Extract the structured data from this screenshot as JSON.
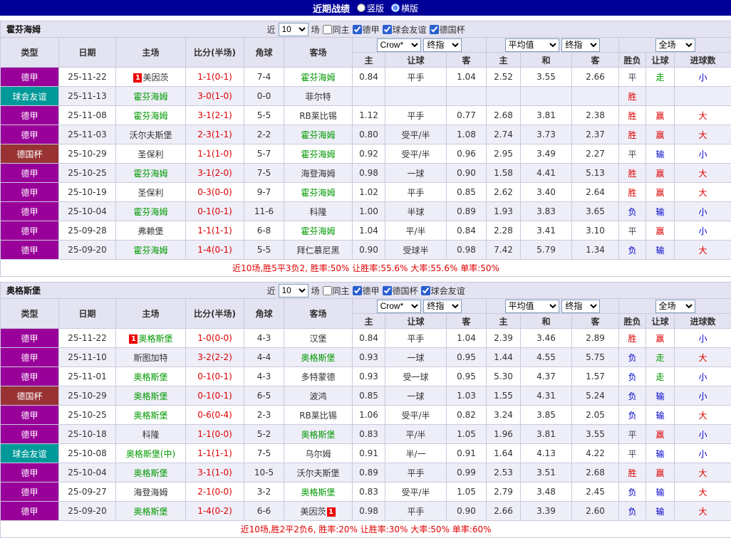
{
  "topbar": {
    "title": "近期战绩",
    "radios": [
      {
        "label": "竖版",
        "selected": false
      },
      {
        "label": "横版",
        "selected": true
      }
    ]
  },
  "colors": {
    "type": {
      "德甲": "#990099",
      "球会友谊": "#009999",
      "德国杯": "#993333"
    },
    "values": {
      "胜": "#dd0000",
      "平": "#444455",
      "负": "#0000cc",
      "赢": "#dd0000",
      "走": "#009900",
      "输": "#0000cc",
      "大": "#dd0000",
      "小": "#0000cc"
    },
    "focus_team": "#009900",
    "score": "#dd0000",
    "badge_bg": "#ee0000",
    "summary": "#e00000"
  },
  "table": {
    "columns": [
      "类型",
      "日期",
      "主场",
      "比分(半场)",
      "角球",
      "客场",
      "主",
      "让球",
      "客",
      "主",
      "和",
      "客",
      "胜负",
      "让球",
      "进球数"
    ]
  },
  "sections": [
    {
      "team": "霍芬海姆",
      "filters": {
        "prefix": "近",
        "count": "10",
        "suffix": "场",
        "checkboxes": [
          {
            "label": "同主",
            "checked": false
          },
          {
            "label": "德甲",
            "checked": true
          },
          {
            "label": "球会友谊",
            "checked": true
          },
          {
            "label": "德国杯",
            "checked": true
          }
        ]
      },
      "selects": {
        "asia_company": "Crow*",
        "asia_stage": "终指",
        "europe_company": "平均值",
        "europe_stage": "终指",
        "scope": "全场"
      },
      "rows": [
        {
          "type": "德甲",
          "date": "25-11-22",
          "home": "美因茨",
          "home_badge": "1",
          "home_badge_pos": "left",
          "home_focus": false,
          "score": "1-1(0-1)",
          "corner": "7-4",
          "away": "霍芬海姆",
          "away_focus": true,
          "ah": [
            "0.84",
            "平手",
            "1.04"
          ],
          "eu": [
            "2.52",
            "3.55",
            "2.66"
          ],
          "res": [
            "平",
            "走",
            "小"
          ]
        },
        {
          "type": "球会友谊",
          "date": "25-11-13",
          "home": "霍芬海姆",
          "home_focus": true,
          "score": "3-0(1-0)",
          "corner": "0-0",
          "away": "菲尔特",
          "away_focus": false,
          "ah": [
            "",
            "",
            ""
          ],
          "eu": [
            "",
            "",
            ""
          ],
          "res": [
            "胜",
            "",
            ""
          ]
        },
        {
          "type": "德甲",
          "date": "25-11-08",
          "home": "霍芬海姆",
          "home_focus": true,
          "score": "3-1(2-1)",
          "corner": "5-5",
          "away": "RB莱比锡",
          "away_focus": false,
          "ah": [
            "1.12",
            "平手",
            "0.77"
          ],
          "eu": [
            "2.68",
            "3.81",
            "2.38"
          ],
          "res": [
            "胜",
            "赢",
            "大"
          ]
        },
        {
          "type": "德甲",
          "date": "25-11-03",
          "home": "沃尔夫斯堡",
          "home_focus": false,
          "score": "2-3(1-1)",
          "corner": "2-2",
          "away": "霍芬海姆",
          "away_focus": true,
          "ah": [
            "0.80",
            "受平/半",
            "1.08"
          ],
          "eu": [
            "2.74",
            "3.73",
            "2.37"
          ],
          "res": [
            "胜",
            "赢",
            "大"
          ]
        },
        {
          "type": "德国杯",
          "date": "25-10-29",
          "home": "圣保利",
          "home_focus": false,
          "score": "1-1(1-0)",
          "corner": "5-7",
          "away": "霍芬海姆",
          "away_focus": true,
          "ah": [
            "0.92",
            "受平/半",
            "0.96"
          ],
          "eu": [
            "2.95",
            "3.49",
            "2.27"
          ],
          "res": [
            "平",
            "输",
            "小"
          ]
        },
        {
          "type": "德甲",
          "date": "25-10-25",
          "home": "霍芬海姆",
          "home_focus": true,
          "score": "3-1(2-0)",
          "corner": "7-5",
          "away": "海登海姆",
          "away_focus": false,
          "ah": [
            "0.98",
            "一球",
            "0.90"
          ],
          "eu": [
            "1.58",
            "4.41",
            "5.13"
          ],
          "res": [
            "胜",
            "赢",
            "大"
          ]
        },
        {
          "type": "德甲",
          "date": "25-10-19",
          "home": "圣保利",
          "home_focus": false,
          "score": "0-3(0-0)",
          "corner": "9-7",
          "away": "霍芬海姆",
          "away_focus": true,
          "ah": [
            "1.02",
            "平手",
            "0.85"
          ],
          "eu": [
            "2.62",
            "3.40",
            "2.64"
          ],
          "res": [
            "胜",
            "赢",
            "大"
          ]
        },
        {
          "type": "德甲",
          "date": "25-10-04",
          "home": "霍芬海姆",
          "home_focus": true,
          "score": "0-1(0-1)",
          "corner": "11-6",
          "away": "科隆",
          "away_focus": false,
          "ah": [
            "1.00",
            "半球",
            "0.89"
          ],
          "eu": [
            "1.93",
            "3.83",
            "3.65"
          ],
          "res": [
            "负",
            "输",
            "小"
          ]
        },
        {
          "type": "德甲",
          "date": "25-09-28",
          "home": "弗赖堡",
          "home_focus": false,
          "score": "1-1(1-1)",
          "corner": "6-8",
          "away": "霍芬海姆",
          "away_focus": true,
          "ah": [
            "1.04",
            "平/半",
            "0.84"
          ],
          "eu": [
            "2.28",
            "3.41",
            "3.10"
          ],
          "res": [
            "平",
            "赢",
            "小"
          ]
        },
        {
          "type": "德甲",
          "date": "25-09-20",
          "home": "霍芬海姆",
          "home_focus": true,
          "score": "1-4(0-1)",
          "corner": "5-5",
          "away": "拜仁慕尼黑",
          "away_focus": false,
          "ah": [
            "0.90",
            "受球半",
            "0.98"
          ],
          "eu": [
            "7.42",
            "5.79",
            "1.34"
          ],
          "res": [
            "负",
            "输",
            "大"
          ]
        }
      ],
      "summary": "近10场,胜5平3负2, 胜率:50% 让胜率:55.6% 大率:55.6% 单率:50%"
    },
    {
      "team": "奥格斯堡",
      "filters": {
        "prefix": "近",
        "count": "10",
        "suffix": "场",
        "checkboxes": [
          {
            "label": "同主",
            "checked": false
          },
          {
            "label": "德甲",
            "checked": true
          },
          {
            "label": "德国杯",
            "checked": true
          },
          {
            "label": "球会友谊",
            "checked": true
          }
        ]
      },
      "selects": {
        "asia_company": "Crow*",
        "asia_stage": "终指",
        "europe_company": "平均值",
        "europe_stage": "终指",
        "scope": "全场"
      },
      "rows": [
        {
          "type": "德甲",
          "date": "25-11-22",
          "home": "奥格斯堡",
          "home_badge": "1",
          "home_badge_pos": "left",
          "home_focus": true,
          "score": "1-0(0-0)",
          "corner": "4-3",
          "away": "汉堡",
          "away_focus": false,
          "ah": [
            "0.84",
            "平手",
            "1.04"
          ],
          "eu": [
            "2.39",
            "3.46",
            "2.89"
          ],
          "res": [
            "胜",
            "赢",
            "小"
          ]
        },
        {
          "type": "德甲",
          "date": "25-11-10",
          "home": "斯图加特",
          "home_focus": false,
          "score": "3-2(2-2)",
          "corner": "4-4",
          "away": "奥格斯堡",
          "away_focus": true,
          "ah": [
            "0.93",
            "一球",
            "0.95"
          ],
          "eu": [
            "1.44",
            "4.55",
            "5.75"
          ],
          "res": [
            "负",
            "走",
            "大"
          ]
        },
        {
          "type": "德甲",
          "date": "25-11-01",
          "home": "奥格斯堡",
          "home_focus": true,
          "score": "0-1(0-1)",
          "corner": "4-3",
          "away": "多特蒙德",
          "away_focus": false,
          "ah": [
            "0.93",
            "受一球",
            "0.95"
          ],
          "eu": [
            "5.30",
            "4.37",
            "1.57"
          ],
          "res": [
            "负",
            "走",
            "小"
          ]
        },
        {
          "type": "德国杯",
          "date": "25-10-29",
          "home": "奥格斯堡",
          "home_focus": true,
          "score": "0-1(0-1)",
          "corner": "6-5",
          "away": "波鸿",
          "away_focus": false,
          "ah": [
            "0.85",
            "一球",
            "1.03"
          ],
          "eu": [
            "1.55",
            "4.31",
            "5.24"
          ],
          "res": [
            "负",
            "输",
            "小"
          ]
        },
        {
          "type": "德甲",
          "date": "25-10-25",
          "home": "奥格斯堡",
          "home_focus": true,
          "score": "0-6(0-4)",
          "corner": "2-3",
          "away": "RB莱比锡",
          "away_focus": false,
          "ah": [
            "1.06",
            "受平/半",
            "0.82"
          ],
          "eu": [
            "3.24",
            "3.85",
            "2.05"
          ],
          "res": [
            "负",
            "输",
            "大"
          ]
        },
        {
          "type": "德甲",
          "date": "25-10-18",
          "home": "科隆",
          "home_focus": false,
          "score": "1-1(0-0)",
          "corner": "5-2",
          "away": "奥格斯堡",
          "away_focus": true,
          "ah": [
            "0.83",
            "平/半",
            "1.05"
          ],
          "eu": [
            "1.96",
            "3.81",
            "3.55"
          ],
          "res": [
            "平",
            "赢",
            "小"
          ]
        },
        {
          "type": "球会友谊",
          "date": "25-10-08",
          "home": "奥格斯堡(中)",
          "home_focus": true,
          "score": "1-1(1-1)",
          "corner": "7-5",
          "away": "乌尔姆",
          "away_focus": false,
          "ah": [
            "0.91",
            "半/一",
            "0.91"
          ],
          "eu": [
            "1.64",
            "4.13",
            "4.22"
          ],
          "res": [
            "平",
            "输",
            "小"
          ]
        },
        {
          "type": "德甲",
          "date": "25-10-04",
          "home": "奥格斯堡",
          "home_focus": true,
          "score": "3-1(1-0)",
          "corner": "10-5",
          "away": "沃尔夫斯堡",
          "away_focus": false,
          "ah": [
            "0.89",
            "平手",
            "0.99"
          ],
          "eu": [
            "2.53",
            "3.51",
            "2.68"
          ],
          "res": [
            "胜",
            "赢",
            "大"
          ]
        },
        {
          "type": "德甲",
          "date": "25-09-27",
          "home": "海登海姆",
          "home_focus": false,
          "score": "2-1(0-0)",
          "corner": "3-2",
          "away": "奥格斯堡",
          "away_focus": true,
          "ah": [
            "0.83",
            "受平/半",
            "1.05"
          ],
          "eu": [
            "2.79",
            "3.48",
            "2.45"
          ],
          "res": [
            "负",
            "输",
            "大"
          ]
        },
        {
          "type": "德甲",
          "date": "25-09-20",
          "home": "奥格斯堡",
          "home_focus": true,
          "score": "1-4(0-2)",
          "corner": "6-6",
          "away": "美因茨",
          "away_badge": "1",
          "away_badge_pos": "right",
          "away_focus": false,
          "ah": [
            "0.98",
            "平手",
            "0.90"
          ],
          "eu": [
            "2.66",
            "3.39",
            "2.60"
          ],
          "res": [
            "负",
            "输",
            "大"
          ]
        }
      ],
      "summary": "近10场,胜2平2负6, 胜率:20% 让胜率:30% 大率:50% 单率:60%"
    }
  ]
}
